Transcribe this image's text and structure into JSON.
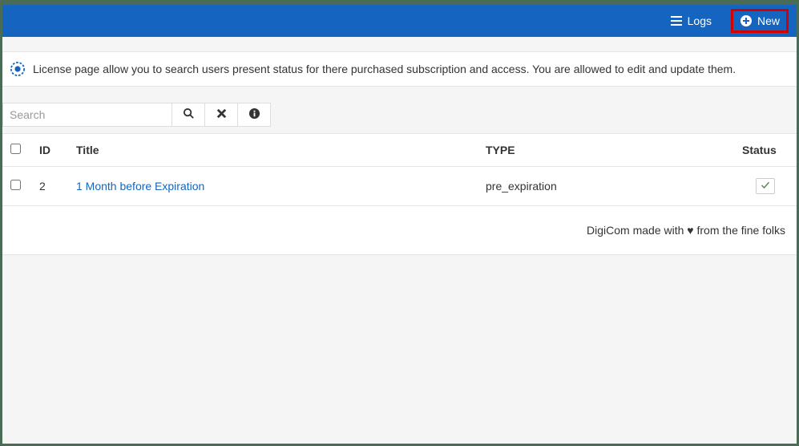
{
  "toolbar": {
    "logs_label": "Logs",
    "new_label": "New"
  },
  "info": {
    "text": "License page allow you to search users present status for there purchased subscription and access. You are allowed to edit and update them."
  },
  "search": {
    "placeholder": "Search",
    "value": ""
  },
  "table": {
    "headers": {
      "id": "ID",
      "title": "Title",
      "type": "TYPE",
      "status": "Status"
    },
    "rows": [
      {
        "id": "2",
        "title": "1 Month before Expiration",
        "type": "pre_expiration",
        "status": true
      }
    ]
  },
  "footer": {
    "prefix": "DigiCom made with ",
    "heart": "♥",
    "suffix": " from the fine folks"
  }
}
